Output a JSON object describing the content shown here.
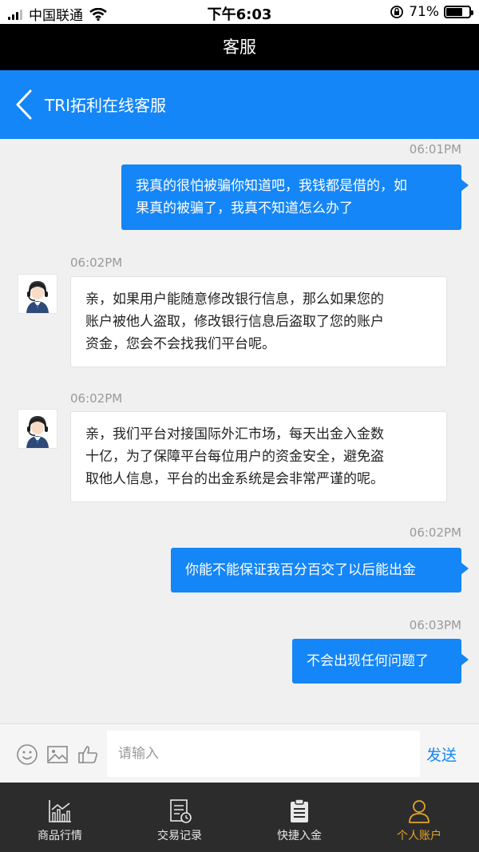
{
  "status_bar": {
    "carrier": "中国联通",
    "time": "下午6:03",
    "battery_percent": "71%",
    "battery_level": 0.71
  },
  "header": {
    "title": "客服"
  },
  "nav": {
    "title": "TRI拓利在线客服"
  },
  "messages": [
    {
      "side": "out",
      "time": "06:01PM",
      "line1": "我真的很怕被骗你知道吧，我钱都是借的，如",
      "line2": "果真的被骗了，我真不知道怎么办了"
    },
    {
      "side": "in",
      "time": "06:02PM",
      "line1": "亲，如果用户能随意修改银行信息，那么如果您的",
      "line2": "账户被他人盗取，修改银行信息后盗取了您的账户",
      "line3": "资金，您会不会找我们平台呢。"
    },
    {
      "side": "in",
      "time": "06:02PM",
      "line1": "亲，我们平台对接国际外汇市场，每天出金入金数",
      "line2": "十亿，为了保障平台每位用户的资金安全，避免盗",
      "line3": "取他人信息，平台的出金系统是会非常严谨的呢。"
    },
    {
      "side": "out",
      "time": "06:02PM",
      "line1": "你能不能保证我百分百交了以后能出金"
    },
    {
      "side": "out",
      "time": "06:03PM",
      "line1": "不会出现任何问题了"
    }
  ],
  "input_bar": {
    "placeholder": "请输入",
    "send_label": "发送"
  },
  "tabs": [
    {
      "label": "商品行情",
      "icon": "chart-icon"
    },
    {
      "label": "交易记录",
      "icon": "record-icon"
    },
    {
      "label": "快捷入金",
      "icon": "clipboard-icon"
    },
    {
      "label": "个人账户",
      "icon": "person-icon",
      "active": true
    }
  ],
  "colors": {
    "accent": "#1486f7",
    "active_tab": "#e5a52a",
    "tab_bar": "#2c2c2c"
  }
}
